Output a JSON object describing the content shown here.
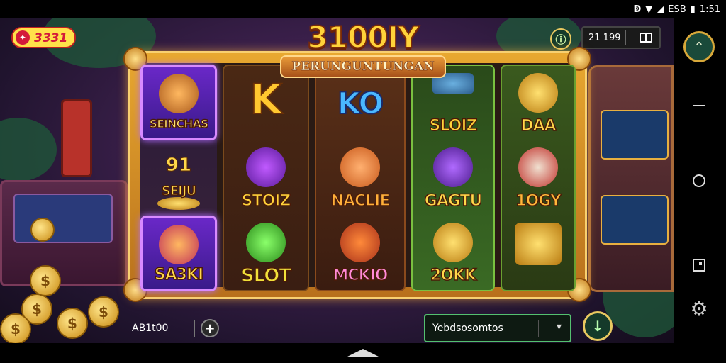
{
  "status_bar": {
    "time": "1:51",
    "battery_label": "ESB"
  },
  "logo": {
    "text": "3331"
  },
  "header": {
    "balance_value": "21 199"
  },
  "title": {
    "main": "3100IY",
    "sub": "PERUNGUNTUNGAN"
  },
  "reels": [
    {
      "symbols": [
        {
          "label": "SEINCHAS",
          "color": "#ffe070",
          "highlight": true
        },
        {
          "label": "SEIJU",
          "color": "#ffd84a",
          "prefix": "91",
          "highlight": false
        },
        {
          "label": "SA3KI",
          "color": "#ffd84a",
          "highlight": true
        }
      ]
    },
    {
      "symbols": [
        {
          "label": "",
          "color": "#ffc830",
          "highlight": false
        },
        {
          "label": "STOIZ",
          "color": "#ffd23a",
          "highlight": false
        },
        {
          "label": "SLOT",
          "color": "#f0e03a",
          "highlight": false
        }
      ]
    },
    {
      "symbols": [
        {
          "label": "KO",
          "color": "#4ab8ff",
          "highlight": false
        },
        {
          "label": "NACLIE",
          "color": "#ffb03a",
          "highlight": false
        },
        {
          "label": "MCKIO",
          "color": "#ff8ad8",
          "highlight": false
        }
      ]
    },
    {
      "symbols": [
        {
          "label": "SLOIZ",
          "color": "#ffd23a",
          "highlight": false
        },
        {
          "label": "GAGTU",
          "color": "#ffd84a",
          "highlight": false
        },
        {
          "label": "2OKK",
          "color": "#ffd84a",
          "highlight": false
        }
      ]
    },
    {
      "symbols": [
        {
          "label": "DAA",
          "color": "#ffd84a",
          "highlight": false
        },
        {
          "label": "1OGY",
          "color": "#ffb83a",
          "highlight": false
        },
        {
          "label": "",
          "color": "#ffd84a",
          "highlight": false
        }
      ]
    }
  ],
  "bottom": {
    "bet_label": "AB1t00",
    "plus_label": "+",
    "select_value": "Yebdsosomtos",
    "chevron": "▾",
    "spin_label": "↓"
  },
  "colors": {
    "accent_gold": "#e8a830",
    "select_border": "#54c070",
    "highlight_purple": "#d88aff"
  }
}
